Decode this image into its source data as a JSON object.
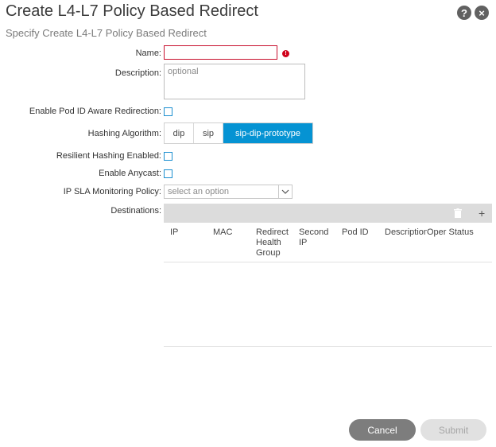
{
  "header": {
    "title": "Create L4-L7 Policy Based Redirect",
    "subtitle": "Specify Create L4-L7 Policy Based Redirect",
    "help_icon": "question-icon",
    "close_icon": "close-icon",
    "help_glyph": "?",
    "close_glyph": "×"
  },
  "form": {
    "name_label": "Name:",
    "name_value": "",
    "required_glyph": "!",
    "description_label": "Description:",
    "description_placeholder": "optional",
    "pod_aware_label": "Enable Pod ID Aware Redirection:",
    "hashing_label": "Hashing Algorithm:",
    "hashing_options": [
      "dip",
      "sip",
      "sip-dip-prototype"
    ],
    "hashing_selected": "sip-dip-prototype",
    "resilient_label": "Resilient Hashing Enabled:",
    "anycast_label": "Enable Anycast:",
    "ipsla_label": "IP SLA Monitoring Policy:",
    "ipsla_placeholder": "select an option",
    "destinations_label": "Destinations:"
  },
  "destinations_table": {
    "delete_icon": "trash-icon",
    "add_icon": "plus-icon",
    "add_glyph": "+",
    "columns": [
      "IP",
      "MAC",
      "Redirect Health Group",
      "Second IP",
      "Pod ID",
      "Description",
      "Oper Status"
    ],
    "rows": []
  },
  "footer": {
    "cancel_label": "Cancel",
    "submit_label": "Submit"
  },
  "colors": {
    "accent": "#0593d3",
    "error": "#d0021b",
    "toolbar_bg": "#dcdcdc"
  }
}
